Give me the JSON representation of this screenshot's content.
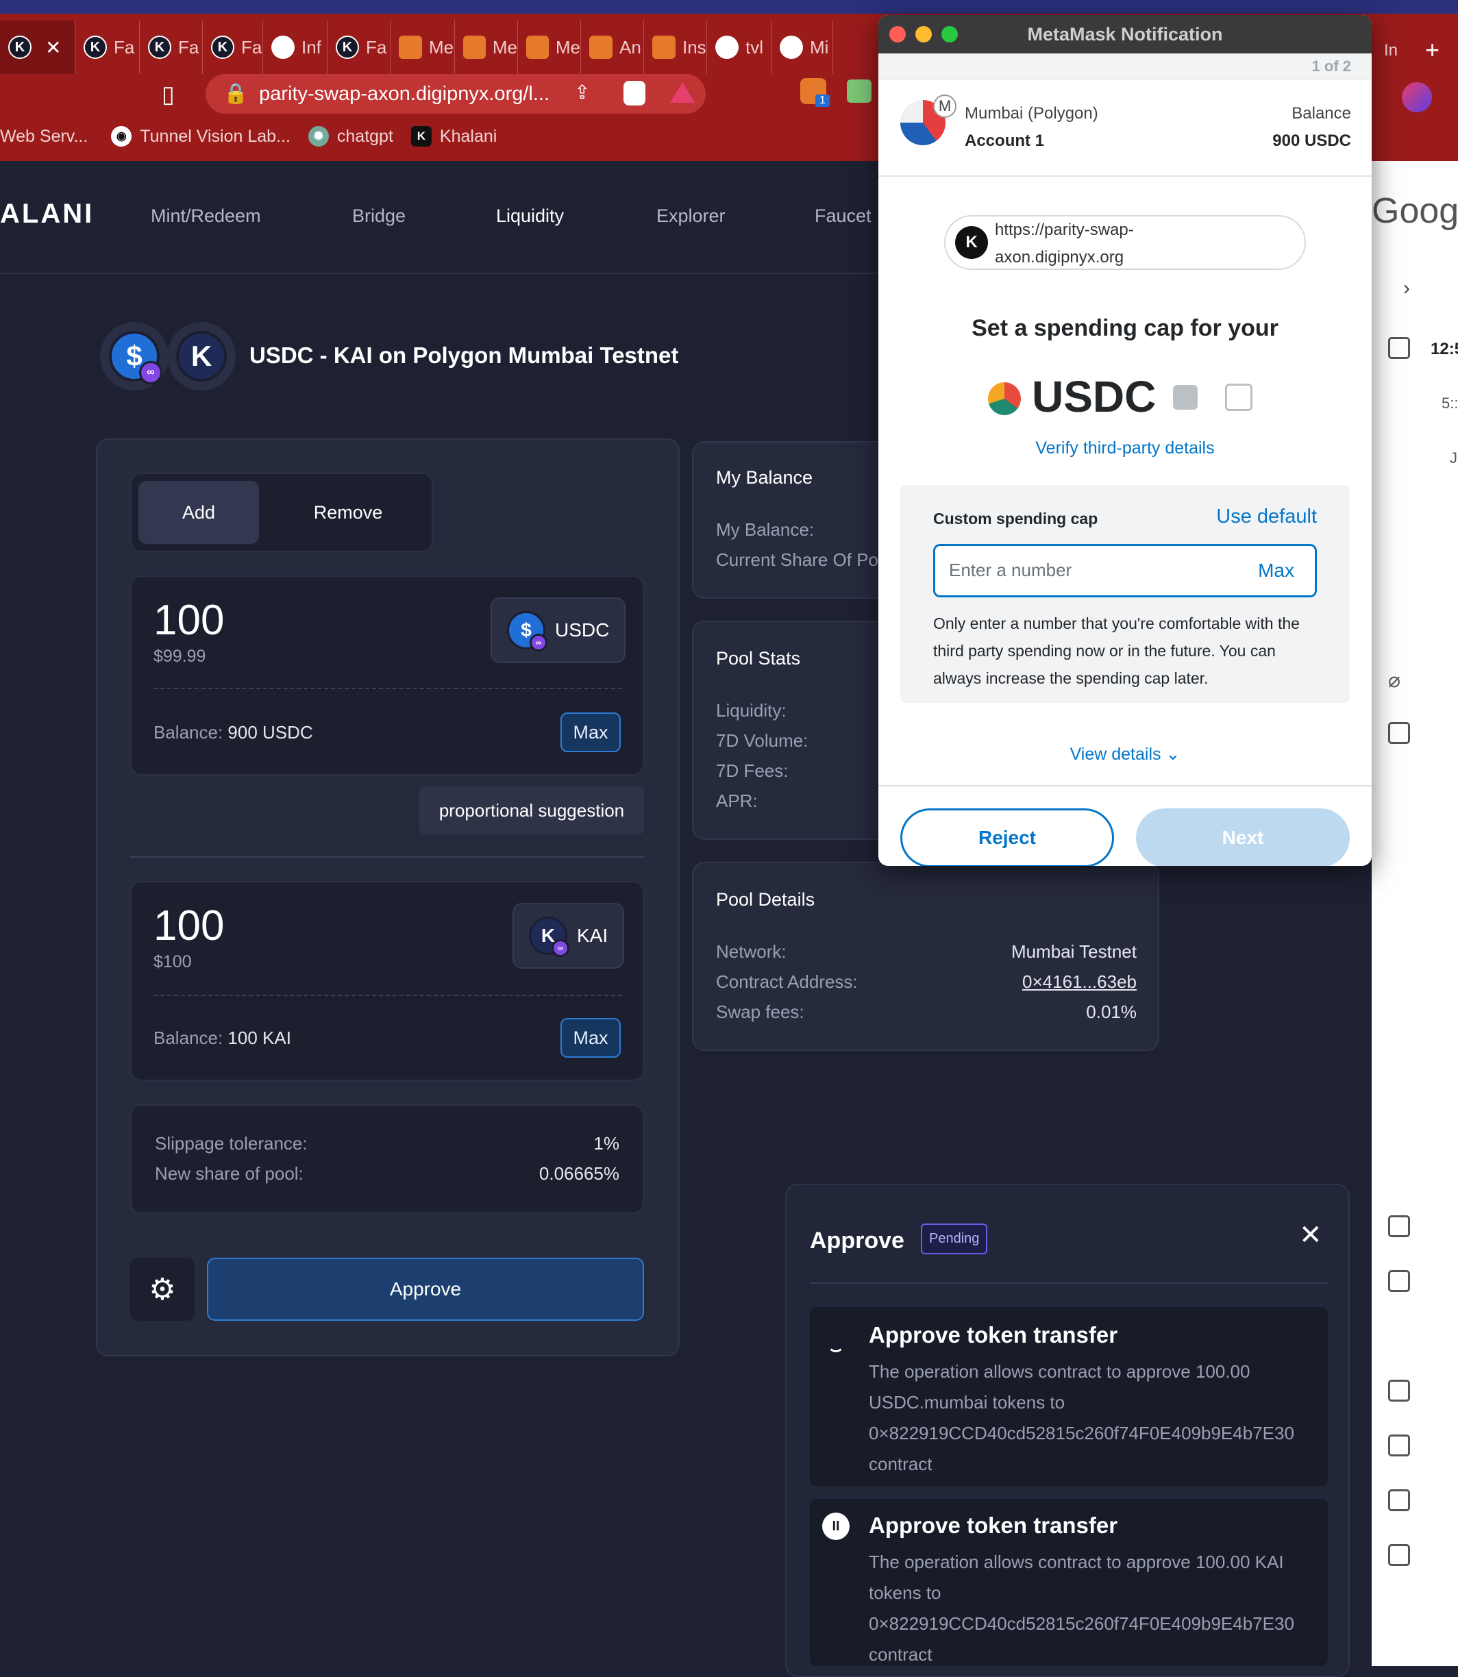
{
  "browser": {
    "tabs": [
      {
        "label": "",
        "icon": "khalani-icon"
      },
      {
        "label": "Fa",
        "icon": "khalani-icon"
      },
      {
        "label": "Fa",
        "icon": "khalani-icon"
      },
      {
        "label": "Fa",
        "icon": "khalani-icon"
      },
      {
        "label": "Inf",
        "icon": "github-icon"
      },
      {
        "label": "Fa",
        "icon": "khalani-icon"
      },
      {
        "label": "Me",
        "icon": "metamask-icon"
      },
      {
        "label": "Me",
        "icon": "metamask-icon"
      },
      {
        "label": "Me",
        "icon": "metamask-icon"
      },
      {
        "label": "An",
        "icon": "cube-icon"
      },
      {
        "label": "Ins",
        "icon": "layers-icon"
      },
      {
        "label": "tvl",
        "icon": "github-icon"
      },
      {
        "label": "Mi",
        "icon": "github-icon"
      }
    ],
    "close_tab_glyph": "✕",
    "right_tab_label": "In",
    "new_tab_glyph": "+",
    "address": "parity-swap-axon.digipnyx.org/l...",
    "extension_badge": "1",
    "bookmarks": [
      {
        "label": "Web Serv...",
        "icon": ""
      },
      {
        "label": "Tunnel Vision Lab...",
        "icon": "github-icon"
      },
      {
        "label": "chatgpt",
        "icon": "openai-icon"
      },
      {
        "label": "Khalani",
        "icon": "khalani-icon"
      }
    ]
  },
  "app": {
    "logo": "ALANI",
    "nav": [
      "Mint/Redeem",
      "Bridge",
      "Liquidity",
      "Explorer",
      "Faucet"
    ],
    "pair_title": "USDC - KAI on Polygon Mumbai Testnet",
    "coin_k_glyph": "K",
    "coin_usdc_glyph": "$",
    "liquidity": {
      "tabs": [
        "Add",
        "Remove"
      ],
      "token1": {
        "amount": "100",
        "usd": "$99.99",
        "symbol": "USDC",
        "balance_label": "Balance:",
        "balance": "900 USDC",
        "max": "Max"
      },
      "suggestion": "proportional suggestion",
      "token2": {
        "amount": "100",
        "usd": "$100",
        "symbol": "KAI",
        "balance_label": "Balance:",
        "balance": "100 KAI",
        "max": "Max"
      },
      "slippage_label": "Slippage tolerance:",
      "slippage": "1%",
      "share_label": "New share of pool:",
      "share": "0.06665%",
      "approve": "Approve"
    },
    "my_balance": {
      "title": "My Balance",
      "rows": [
        "My Balance:",
        "Current Share Of Po"
      ]
    },
    "pool_stats": {
      "title": "Pool Stats",
      "rows": [
        "Liquidity:",
        "7D Volume:",
        "7D Fees:",
        "APR:"
      ]
    },
    "pool_details": {
      "title": "Pool Details",
      "rows": [
        {
          "label": "Network:",
          "value": "Mumbai Testnet"
        },
        {
          "label": "Contract Address:",
          "value": "0×4161...63eb"
        },
        {
          "label": "Swap fees:",
          "value": "0.01%"
        }
      ]
    }
  },
  "metamask": {
    "window_title": "MetaMask Notification",
    "pager": "1 of 2",
    "network": "Mumbai (Polygon)",
    "account": "Account 1",
    "balance_label": "Balance",
    "balance": "900 USDC",
    "site": "https://parity-swap-axon.digipnyx.org",
    "heading": "Set a spending cap for your",
    "token": "USDC",
    "verify": "Verify third-party details",
    "cap_label": "Custom spending cap",
    "use_default": "Use default",
    "input_placeholder": "Enter a number",
    "max": "Max",
    "note": "Only enter a number that you're comfortable with the third party spending now or in the future. You can always increase the spending cap later.",
    "view_details": "View details",
    "reject": "Reject",
    "next": "Next"
  },
  "toast": {
    "title": "Approve",
    "status": "Pending",
    "steps": [
      {
        "title": "Approve token transfer",
        "body": "The operation allows contract to approve 100.00 USDC.mumbai tokens to 0×822919CCD40cd52815c260f74F0E409b9E4b7E30 contract"
      },
      {
        "title": "Approve token transfer",
        "body": "The operation allows contract to approve 100.00 KAI tokens to 0×822919CCD40cd52815c260f74F0E409b9E4b7E30 contract"
      }
    ]
  },
  "side_window": {
    "title": "Googl",
    "time1": "12:5",
    "time2": "5::",
    "letter": "J"
  },
  "colors": {
    "primary": "#1f6fd6",
    "metamask_blue": "#0376c9",
    "chrome_red": "#9b1b1b",
    "pending": "#6c5ce7"
  }
}
